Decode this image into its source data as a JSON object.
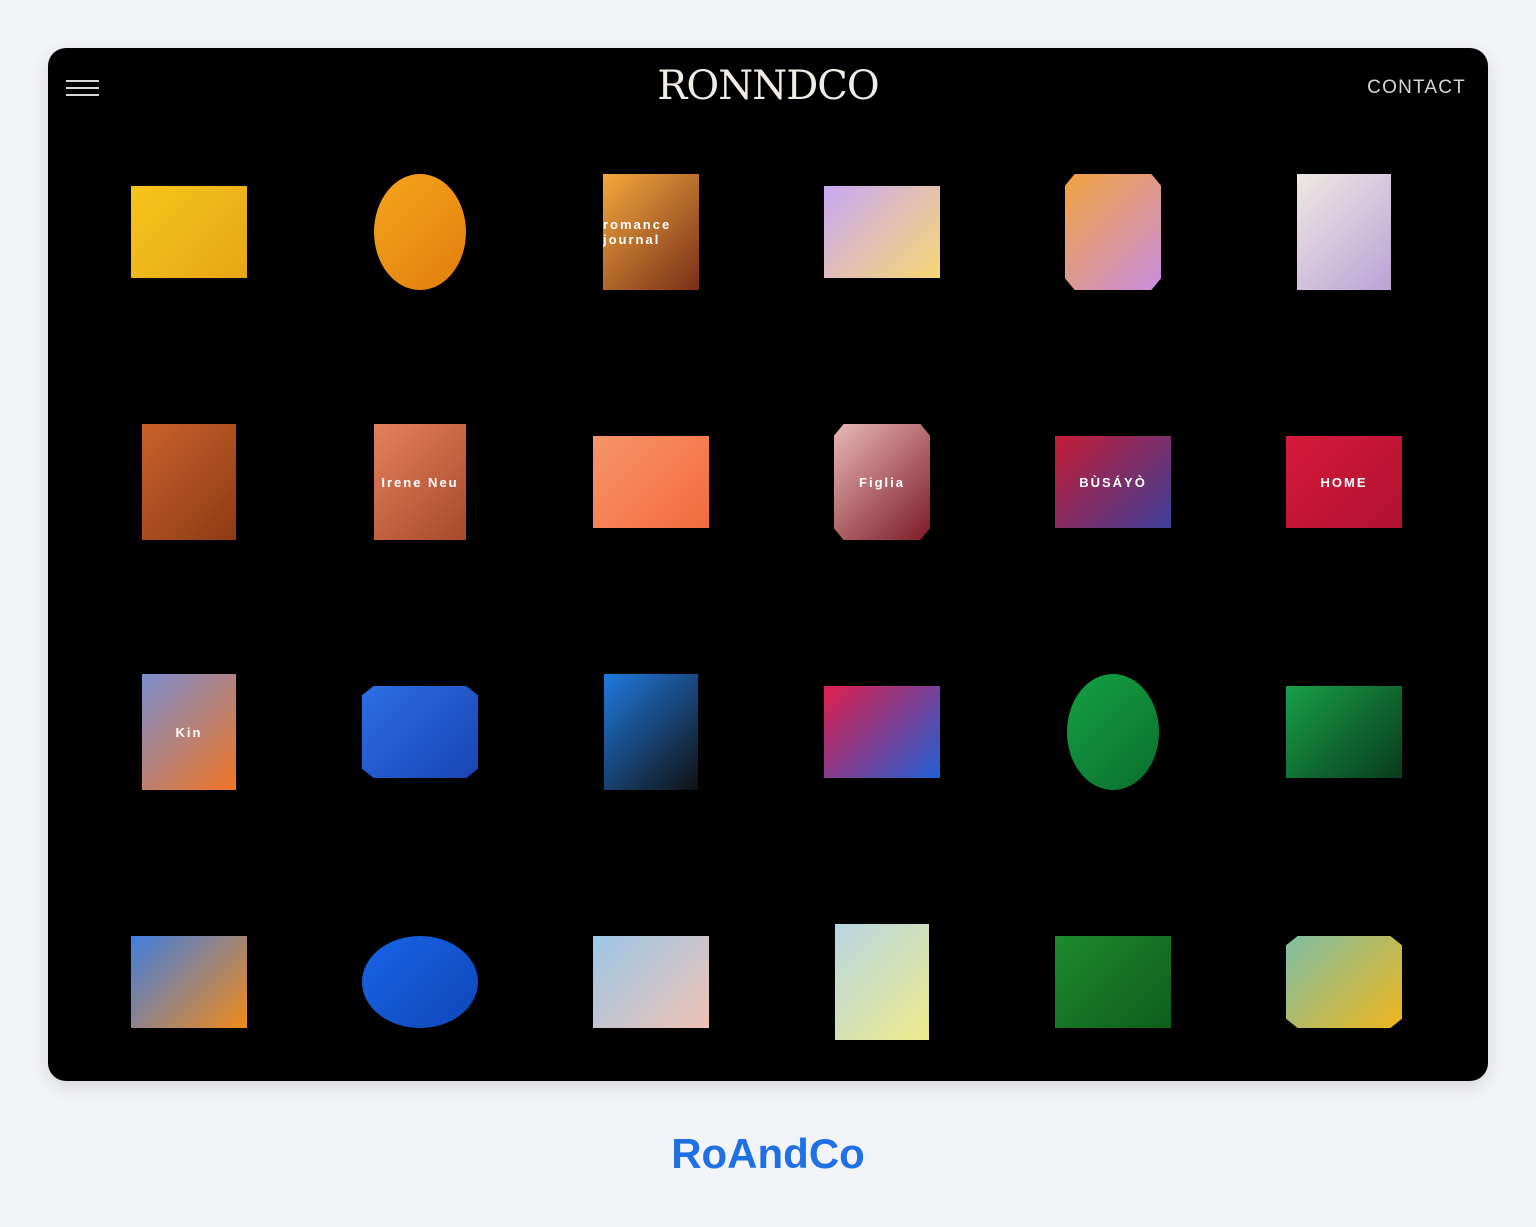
{
  "site": {
    "logo": "RONNDCO",
    "contact_label": "CONTACT",
    "menu_icon": "hamburger-menu-icon"
  },
  "portfolio": {
    "tiles": [
      {
        "name": "coconut-pool",
        "label": "",
        "colors": [
          "#f5c51c",
          "#e8a614"
        ],
        "shape": "rect"
      },
      {
        "name": "martini-glass",
        "label": "",
        "colors": [
          "#f6a51d",
          "#e07d0d"
        ],
        "shape": "ellipse"
      },
      {
        "name": "romance-journal",
        "label": "romance journal",
        "colors": [
          "#f2a83c",
          "#7a2e1a"
        ],
        "shape": "rect"
      },
      {
        "name": "gradient-cube",
        "label": "",
        "colors": [
          "#c9a7f5",
          "#f7d873"
        ],
        "shape": "rect"
      },
      {
        "name": "pumpkins-pearls",
        "label": "",
        "colors": [
          "#f2a33d",
          "#c98ee0"
        ],
        "shape": "octagon"
      },
      {
        "name": "soap-bottles",
        "label": "",
        "colors": [
          "#efe8e2",
          "#b9a3d6"
        ],
        "shape": "rect"
      },
      {
        "name": "smiling-man-illustration",
        "label": "",
        "colors": [
          "#c9622a",
          "#8c3a16"
        ],
        "shape": "rect"
      },
      {
        "name": "irene-neuwirth-book",
        "label": "Irene Neu",
        "colors": [
          "#e5805d",
          "#a54a2c"
        ],
        "shape": "rect"
      },
      {
        "name": "orange-wave",
        "label": "",
        "colors": [
          "#f79568",
          "#f26b3d"
        ],
        "shape": "rect"
      },
      {
        "name": "figlia-bottle",
        "label": "Figlia",
        "colors": [
          "#e7b7b6",
          "#7d1a26"
        ],
        "shape": "octagon"
      },
      {
        "name": "busayo-fabric",
        "label": "BÙSÁYÒ",
        "colors": [
          "#c31c34",
          "#3b3f98"
        ],
        "shape": "rect"
      },
      {
        "name": "red-home-print",
        "label": "HOME",
        "colors": [
          "#d6193a",
          "#b01230"
        ],
        "shape": "rect"
      },
      {
        "name": "kin-bottle",
        "label": "Kin",
        "colors": [
          "#7c8fd0",
          "#f17523"
        ],
        "shape": "rect"
      },
      {
        "name": "blue-portrait",
        "label": "",
        "colors": [
          "#2b6fe6",
          "#1a44b2"
        ],
        "shape": "octagon"
      },
      {
        "name": "blue-fur-bag",
        "label": "",
        "colors": [
          "#1f7ae0",
          "#111111"
        ],
        "shape": "rect"
      },
      {
        "name": "colorful-cards",
        "label": "",
        "colors": [
          "#e01f4d",
          "#1f5fd4"
        ],
        "shape": "rect"
      },
      {
        "name": "woman-green-portrait",
        "label": "",
        "colors": [
          "#14a144",
          "#0b6e2c"
        ],
        "shape": "ellipse"
      },
      {
        "name": "green-bottles",
        "label": "",
        "colors": [
          "#18a048",
          "#0a3b1c"
        ],
        "shape": "rect"
      },
      {
        "name": "orange-cactus-fruit",
        "label": "",
        "colors": [
          "#3f7ee0",
          "#f28a1a"
        ],
        "shape": "rect"
      },
      {
        "name": "tennis-player",
        "label": "",
        "colors": [
          "#1764e8",
          "#0f47b8"
        ],
        "shape": "ellipse"
      },
      {
        "name": "pink-tote-bag",
        "label": "",
        "colors": [
          "#9cc7e8",
          "#efc2b4"
        ],
        "shape": "rect"
      },
      {
        "name": "sunscreen-can",
        "label": "",
        "colors": [
          "#b8d6e4",
          "#eeeb8c"
        ],
        "shape": "rect"
      },
      {
        "name": "green-boxes",
        "label": "",
        "colors": [
          "#1c8a2c",
          "#0f5d1c"
        ],
        "shape": "rect"
      },
      {
        "name": "woman-yellow-lamp",
        "label": "",
        "colors": [
          "#7fbfa6",
          "#f0b51c"
        ],
        "shape": "octagon"
      }
    ]
  },
  "caption": {
    "title": "RoAndCo"
  }
}
